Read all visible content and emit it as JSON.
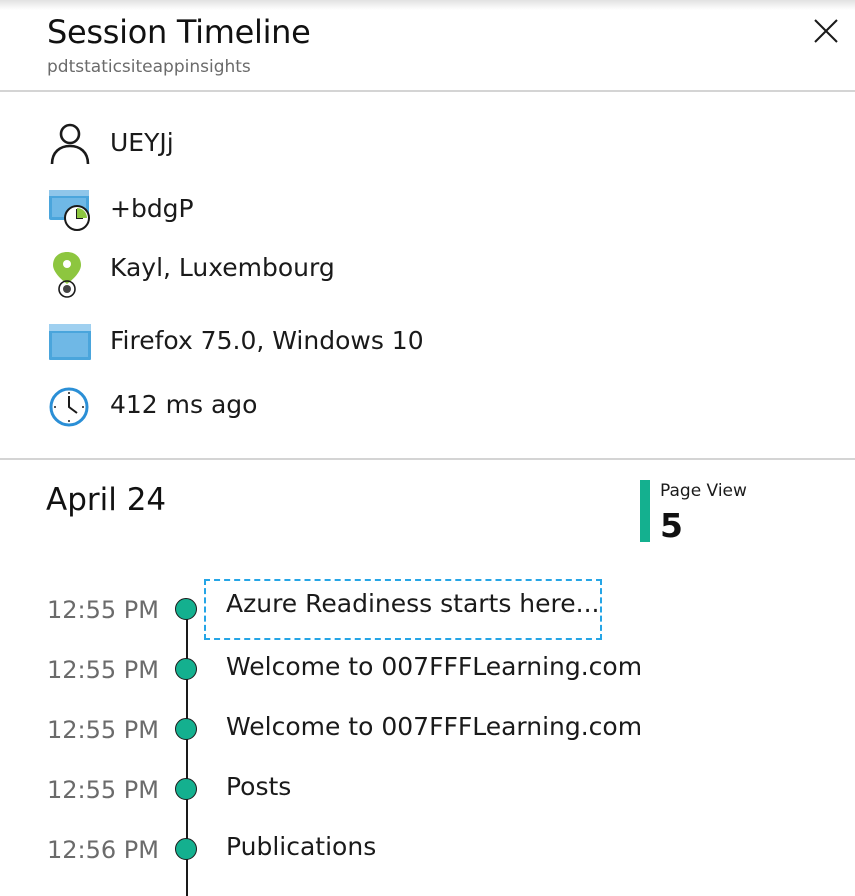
{
  "panel": {
    "title": "Session Timeline",
    "subtitle": "pdtstaticsiteappinsights"
  },
  "icons": {
    "close": "close-icon",
    "user": "user-icon",
    "session": "session-clock-window-icon",
    "location": "map-pin-icon",
    "browser": "browser-window-icon",
    "time": "clock-icon"
  },
  "details": {
    "user_id": "UEYJj",
    "session_id": "+bdgP",
    "location": "Kayl, Luxembourg",
    "browser": "Firefox 75.0, Windows 10",
    "time_ago": "412 ms ago"
  },
  "timeline": {
    "date": "April 24",
    "summary": {
      "label": "Page View",
      "count": "5",
      "color": "#14b08f"
    },
    "events": [
      {
        "time": "12:55 PM",
        "title": "Azure Readiness starts here..."
      },
      {
        "time": "12:55 PM",
        "title": "Welcome to 007FFFLearning.com"
      },
      {
        "time": "12:55 PM",
        "title": "Welcome to 007FFFLearning.com"
      },
      {
        "time": "12:55 PM",
        "title": "Posts"
      },
      {
        "time": "12:56 PM",
        "title": "Publications"
      }
    ]
  },
  "colors": {
    "accent": "#14b08f",
    "focus": "#25a5e6",
    "pin": "#8dc63f",
    "icon_blue": "#4aa5dc"
  }
}
